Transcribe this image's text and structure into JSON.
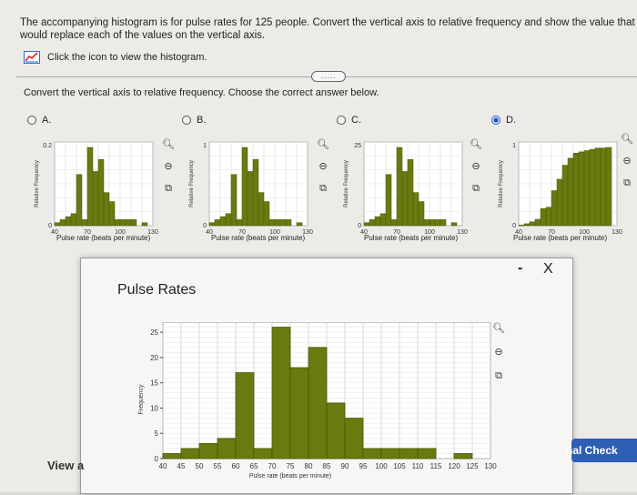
{
  "question": {
    "text": "The accompanying histogram is for pulse rates for 125 people. Convert the vertical axis to relative frequency and show the value that would replace each of the values on the vertical axis.",
    "hint": "Click the icon to view the histogram.",
    "instruction": "Convert the vertical axis to relative frequency. Choose the correct answer below.",
    "more_label": "....."
  },
  "options": [
    {
      "letter": "A.",
      "selected": false,
      "ytick_top": "0.2",
      "y_label": "Relative Frequency",
      "x_label": "Pulse rate (beats per minute)",
      "x_ticks": [
        "40",
        "70",
        "100",
        "130"
      ]
    },
    {
      "letter": "B.",
      "selected": false,
      "ytick_top": "1",
      "y_label": "Relative Frequency",
      "x_label": "Pulse rate (beats per minute)",
      "x_ticks": [
        "40",
        "70",
        "100",
        "130"
      ]
    },
    {
      "letter": "C.",
      "selected": false,
      "ytick_top": "25",
      "y_label": "Relative Frequency",
      "x_label": "Pulse rate (beats per minute)",
      "x_ticks": [
        "40",
        "70",
        "100",
        "130"
      ]
    },
    {
      "letter": "D.",
      "selected": true,
      "ytick_top": "1",
      "y_label": "Relative Frequency",
      "x_label": "Pulse rate (beats per minute)",
      "x_ticks": [
        "40",
        "70",
        "100",
        "130"
      ]
    }
  ],
  "modal": {
    "title": "Pulse Rates",
    "minimize": "-",
    "close": "X"
  },
  "footer": {
    "view_label": "View a",
    "check_label": "nal Check"
  },
  "icons": [
    "chart-line-icon",
    "zoom-in-icon",
    "zoom-out-icon",
    "external-link-icon",
    "close-icon",
    "minimize-icon"
  ],
  "colors": {
    "bar_fill": "#6b7a10",
    "bar_stroke": "#4a5508",
    "check_button": "#2f5fb5",
    "selected_radio": "#1a56c8"
  },
  "chart_data": {
    "type": "bar",
    "title": "Pulse Rates",
    "xlabel": "Pulse rate (beats per minute)",
    "ylabel": "Frequency",
    "ylim": [
      0,
      27
    ],
    "yticks": [
      0,
      5,
      10,
      15,
      20,
      25
    ],
    "xticks": [
      40,
      45,
      50,
      55,
      60,
      65,
      70,
      75,
      80,
      85,
      90,
      95,
      100,
      105,
      110,
      115,
      120,
      125,
      130
    ],
    "bins": [
      {
        "start": 40,
        "end": 45,
        "value": 1
      },
      {
        "start": 45,
        "end": 50,
        "value": 2
      },
      {
        "start": 50,
        "end": 55,
        "value": 3
      },
      {
        "start": 55,
        "end": 60,
        "value": 4
      },
      {
        "start": 60,
        "end": 65,
        "value": 17
      },
      {
        "start": 65,
        "end": 70,
        "value": 2
      },
      {
        "start": 70,
        "end": 75,
        "value": 26
      },
      {
        "start": 75,
        "end": 80,
        "value": 18
      },
      {
        "start": 80,
        "end": 85,
        "value": 22
      },
      {
        "start": 85,
        "end": 90,
        "value": 11
      },
      {
        "start": 90,
        "end": 95,
        "value": 8
      },
      {
        "start": 95,
        "end": 100,
        "value": 2
      },
      {
        "start": 100,
        "end": 105,
        "value": 2
      },
      {
        "start": 105,
        "end": 110,
        "value": 2
      },
      {
        "start": 110,
        "end": 115,
        "value": 2
      },
      {
        "start": 115,
        "end": 120,
        "value": 0
      },
      {
        "start": 120,
        "end": 125,
        "value": 1
      }
    ],
    "grid": true
  }
}
